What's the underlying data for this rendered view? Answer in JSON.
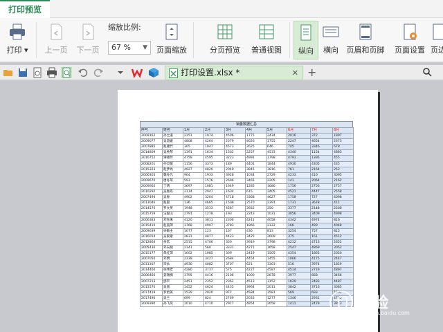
{
  "app": {
    "active_tab": "打印预览"
  },
  "ribbon": {
    "print_label": "打印",
    "prev_page_label": "上一页",
    "next_page_label": "下一页",
    "zoom_label": "缩放比例:",
    "zoom_value": "67 %",
    "page_zoom_label": "页面缩放",
    "page_break_label": "分页预览",
    "normal_view_label": "普通视图",
    "portrait_label": "纵向",
    "landscape_label": "横向",
    "header_footer_label": "页眉和页脚",
    "page_setup_label": "页面设置",
    "page_margin_label": "页边"
  },
  "document": {
    "tab_name": "打印设置.xlsx *"
  },
  "sheet": {
    "title": "销量数据汇总",
    "headers": [
      "序号",
      "姓名",
      "1月",
      "2月",
      "3月",
      "4月",
      "5月",
      "6月",
      "7月",
      "8月"
    ],
    "rows": [
      [
        "2009162",
        "孙之道",
        "2151",
        "1974",
        "4506",
        "1775",
        "2434",
        "2016",
        "372",
        "1997"
      ],
      [
        "2009077",
        "吴淑媛",
        "4808",
        "4264",
        "2379",
        "4626",
        "1755",
        "2247",
        "4654",
        "2373"
      ],
      [
        "2007885",
        "赵顺代",
        "305",
        "1947",
        "4573",
        "2625",
        "646",
        "745",
        "3346",
        "678"
      ],
      [
        "2014809",
        "吴秀琴",
        "1391",
        "1634",
        "1502",
        "2257",
        "4533",
        "4340",
        "1154",
        "4883"
      ],
      [
        "2016752",
        "谭德玲",
        "4759",
        "4595",
        "3223",
        "4991",
        "1798",
        "4791",
        "1395",
        "455"
      ],
      [
        "2008201",
        "孙灵敏",
        "1156",
        "3373",
        "189",
        "4401",
        "1844",
        "4930",
        "4305",
        "435"
      ],
      [
        "2015323",
        "赵梦尚",
        "4927",
        "4820",
        "2040",
        "3845",
        "3816",
        "761",
        "2164",
        "252"
      ],
      [
        "2006305",
        "魏冬凡",
        "964",
        "1933",
        "3928",
        "1034",
        "2729",
        "4233",
        "416",
        "3095"
      ],
      [
        "2009670",
        "唐冬琴",
        "593",
        "1576",
        "2696",
        "3465",
        "2205",
        "141",
        "2064",
        "2162"
      ],
      [
        "2009062",
        "丁炳",
        "3697",
        "1081",
        "1649",
        "1285",
        "1686",
        "1756",
        "2756",
        "2757"
      ],
      [
        "2010292",
        "吴春丹",
        "2114",
        "2947",
        "1634",
        "615",
        "3405",
        "4521",
        "4447",
        "2558"
      ],
      [
        "2007494",
        "吴春",
        "4902",
        "3264",
        "4718",
        "3368",
        "4627",
        "1758",
        "727",
        "4098"
      ],
      [
        "2013046",
        "赵雷",
        "136",
        "4665",
        "1508",
        "2570",
        "2391",
        "1731",
        "3678",
        "411"
      ],
      [
        "2014576",
        "罗文英",
        "1948",
        "3533",
        "4587",
        "3922",
        "250",
        "3377",
        "2148",
        "2500"
      ],
      [
        "2015759",
        "汪俊山",
        "2791",
        "1278",
        "193",
        "2243",
        "1031",
        "3056",
        "3409",
        "4998"
      ],
      [
        "2006383",
        "邓东来",
        "4120",
        "3811",
        "2306",
        "4241",
        "4058",
        "4342",
        "4974",
        "816"
      ],
      [
        "2015410",
        "赵丽萍",
        "3768",
        "4997",
        "3783",
        "1866",
        "2122",
        "166",
        "499",
        "4048"
      ],
      [
        "2009039",
        "徐敏主",
        "1077",
        "123",
        "167",
        "436",
        "813",
        "3254",
        "757",
        "815"
      ],
      [
        "2016014",
        "吴家斯",
        "2831",
        "4877",
        "4423",
        "3425",
        "2609",
        "375",
        "161",
        "4512"
      ],
      [
        "2012864",
        "余玄",
        "2515",
        "4706",
        "350",
        "3919",
        "3798",
        "4212",
        "4713",
        "2652"
      ],
      [
        "2005436",
        "邓天娟",
        "2141",
        "560",
        "3331",
        "4271",
        "1658",
        "2547",
        "4869",
        "3052"
      ],
      [
        "2015177",
        "朱红萍",
        "1002",
        "1085",
        "309",
        "2419",
        "1505",
        "4354",
        "1865",
        "2020"
      ],
      [
        "2007050",
        "邓明",
        "2339",
        "3427",
        "2684",
        "4454",
        "1455",
        "1066",
        "4175",
        "2447"
      ],
      [
        "2011307",
        "宋永",
        "4930",
        "4082",
        "3707",
        "621",
        "3303",
        "516",
        "3974",
        "1819"
      ],
      [
        "2014460",
        "徐伟宏",
        "4280",
        "3737",
        "575",
        "4227",
        "4587",
        "4514",
        "2719",
        "4897"
      ],
      [
        "2006466",
        "姜瑞梅",
        "3795",
        "4416",
        "2106",
        "1000",
        "2878",
        "3977",
        "668",
        "3466"
      ],
      [
        "2007213",
        "邵平",
        "2451",
        "2352",
        "2362",
        "4513",
        "3152",
        "1029",
        "2483",
        "4487"
      ],
      [
        "2015570",
        "吴丽",
        "1452",
        "4624",
        "4435",
        "3964",
        "2011",
        "3842",
        "3716",
        "3085"
      ],
      [
        "2017419",
        "罗奶英",
        "1529",
        "2920",
        "971",
        "4584",
        "3581",
        "569",
        "693",
        "1901"
      ],
      [
        "2017490",
        "吴兰",
        "699",
        "824",
        "2769",
        "2033",
        "1277",
        "1346",
        "2931",
        "4755"
      ],
      [
        "2009390",
        "孙飞凤",
        "2010",
        "4710",
        "2917",
        "4854",
        "2658",
        "1411",
        "2479",
        "3813"
      ]
    ]
  },
  "watermark": {
    "text": "经验",
    "url": "jingyan.baidu.com"
  }
}
